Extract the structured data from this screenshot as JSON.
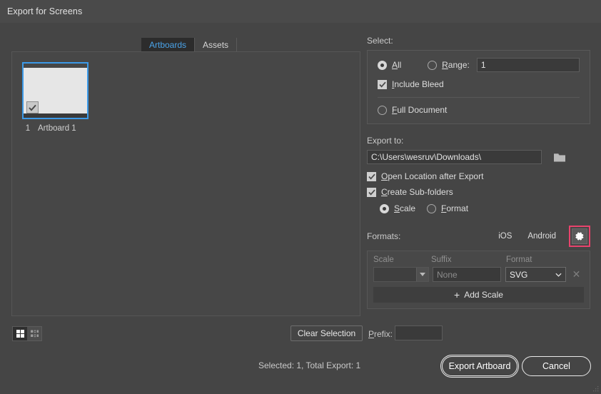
{
  "window": {
    "title": "Export for Screens"
  },
  "tabs": [
    {
      "label": "Artboards",
      "active": true
    },
    {
      "label": "Assets",
      "active": false
    }
  ],
  "artboards": [
    {
      "number": "1",
      "name": "Artboard 1",
      "selected": true,
      "checked": true
    }
  ],
  "select": {
    "heading": "Select:",
    "all_label": "All",
    "range_label": "Range:",
    "range_value": "1",
    "include_bleed_label": "Include Bleed",
    "full_document_label": "Full Document"
  },
  "export_to": {
    "heading": "Export to:",
    "path_value": "C:\\Users\\wesruv\\Downloads\\",
    "folder_icon": "folder-icon",
    "open_location_label": "Open Location after Export",
    "create_subfolders_label": "Create Sub-folders",
    "scale_label": "Scale",
    "format_label": "Format"
  },
  "formats": {
    "heading": "Formats:",
    "presets": [
      "iOS",
      "Android"
    ],
    "gear_icon": "gear-icon",
    "highlight_color": "#e8436c",
    "columns": [
      "Scale",
      "Suffix",
      "Format"
    ],
    "rows": [
      {
        "scale": "",
        "suffix_placeholder": "None",
        "format": "SVG"
      }
    ],
    "add_scale_label": "Add Scale",
    "add_scale_plus": "+"
  },
  "bottom_bar": {
    "grid_view_icon": "grid-view-icon",
    "list_view_icon": "list-view-icon",
    "clear_selection_label": "Clear Selection",
    "prefix_label": "Prefix:",
    "prefix_value": ""
  },
  "footer": {
    "status": "Selected: 1, Total Export: 1",
    "export_button": "Export Artboard",
    "cancel_button": "Cancel"
  },
  "colors": {
    "dialog_bg": "#454545",
    "panel_bg": "#474747",
    "accent_blue": "#3c9ae8",
    "tab_active_text": "#4aa3e8",
    "highlight_pink": "#e8436c"
  }
}
